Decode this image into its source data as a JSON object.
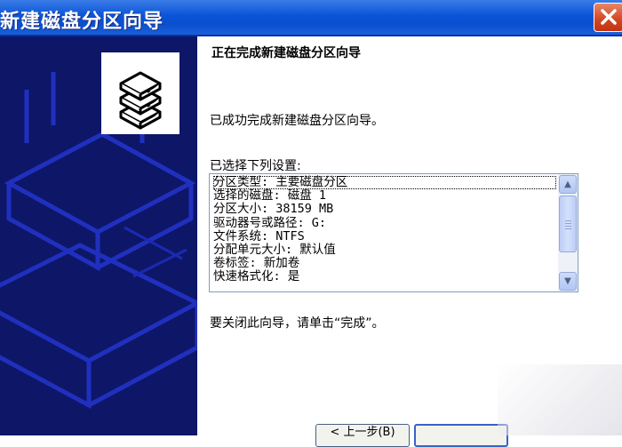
{
  "window": {
    "title": "新建磁盘分区向导",
    "colors": {
      "titlebar": "#0a54d8",
      "banner": "#0e1668",
      "close": "#d24520"
    }
  },
  "banner": {
    "icon": "disk-stack-icon"
  },
  "wizard": {
    "heading": "正在完成新建磁盘分区向导",
    "success_message": "已成功完成新建磁盘分区向导。",
    "settings_label": "已选择下列设置:",
    "settings": [
      "分区类型: 主要磁盘分区",
      "选择的磁盘: 磁盘 1",
      "分区大小: 38159 MB",
      "驱动器号或路径: G:",
      "文件系统: NTFS",
      "分配单元大小: 默认值",
      "卷标签: 新加卷",
      "快速格式化: 是"
    ],
    "close_hint": "要关闭此向导，请单击“完成”。"
  },
  "buttons": {
    "back_label": "< 上一步(B)"
  }
}
